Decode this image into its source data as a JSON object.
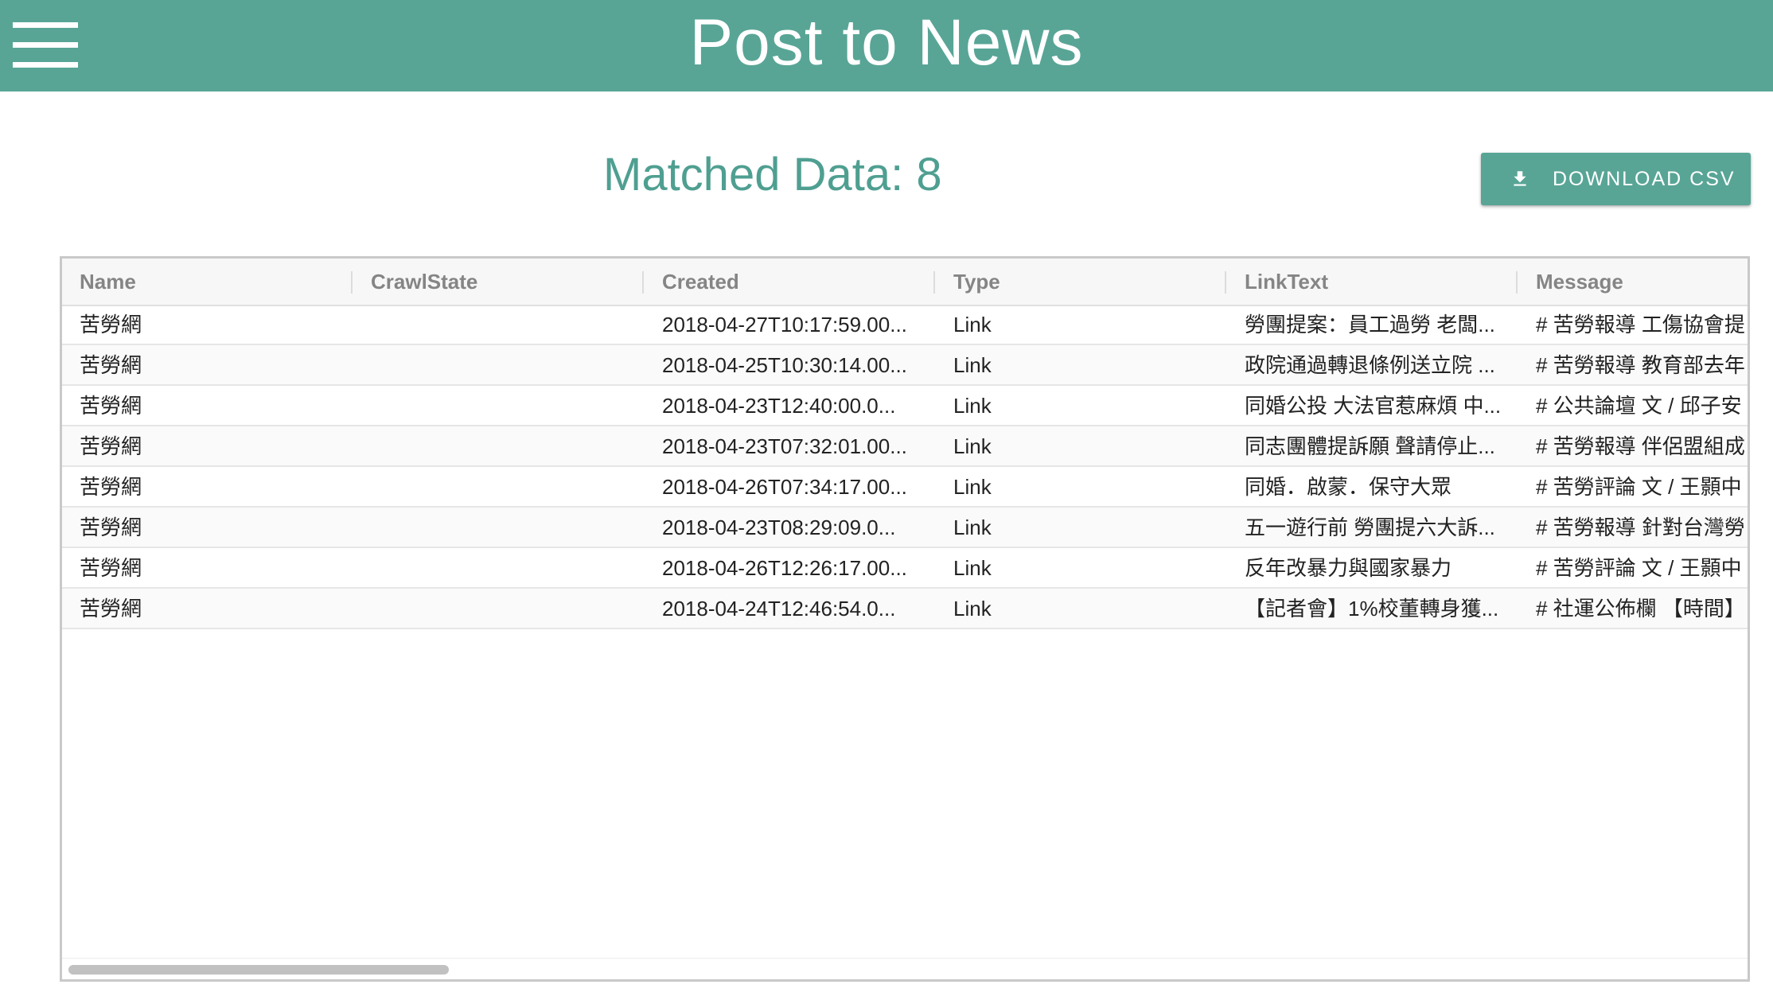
{
  "appbar": {
    "title": "Post to News",
    "menu_icon": "hamburger-menu-icon"
  },
  "summary": {
    "matched_text": "Matched Data: 8"
  },
  "toolbar": {
    "download_label": "DOWNLOAD CSV",
    "download_icon": "download-icon"
  },
  "table": {
    "columns": [
      "Name",
      "CrawlState",
      "Created",
      "Type",
      "LinkText",
      "Message"
    ],
    "rows": [
      {
        "name": "苦勞網",
        "crawlstate": "",
        "created": "2018-04-27T10:17:59.00...",
        "type": "Link",
        "linktext": "勞團提案：員工過勞 老闆...",
        "message": "# 苦勞報導 工傷協會提"
      },
      {
        "name": "苦勞網",
        "crawlstate": "",
        "created": "2018-04-25T10:30:14.00...",
        "type": "Link",
        "linktext": "政院通過轉退條例送立院 ...",
        "message": "# 苦勞報導 教育部去年"
      },
      {
        "name": "苦勞網",
        "crawlstate": "",
        "created": "2018-04-23T12:40:00.0...",
        "type": "Link",
        "linktext": "同婚公投 大法官惹麻煩 中...",
        "message": "# 公共論壇 文 / 邱子安"
      },
      {
        "name": "苦勞網",
        "crawlstate": "",
        "created": "2018-04-23T07:32:01.00...",
        "type": "Link",
        "linktext": "同志團體提訴願 聲請停止...",
        "message": "# 苦勞報導 伴侶盟組成"
      },
      {
        "name": "苦勞網",
        "crawlstate": "",
        "created": "2018-04-26T07:34:17.00...",
        "type": "Link",
        "linktext": "同婚．啟蒙．保守大眾",
        "message": "# 苦勞評論 文 / 王顥中"
      },
      {
        "name": "苦勞網",
        "crawlstate": "",
        "created": "2018-04-23T08:29:09.0...",
        "type": "Link",
        "linktext": "五一遊行前 勞團提六大訴...",
        "message": "# 苦勞報導 針對台灣勞"
      },
      {
        "name": "苦勞網",
        "crawlstate": "",
        "created": "2018-04-26T12:26:17.00...",
        "type": "Link",
        "linktext": "反年改暴力與國家暴力",
        "message": "# 苦勞評論 文 / 王顥中"
      },
      {
        "name": "苦勞網",
        "crawlstate": "",
        "created": "2018-04-24T12:46:54.0...",
        "type": "Link",
        "linktext": "【記者會】1%校董轉身獲...",
        "message": "# 社運公佈欄 【時間】"
      }
    ]
  },
  "colors": {
    "primary": "#58a596",
    "accent_text": "#4f9f91"
  }
}
